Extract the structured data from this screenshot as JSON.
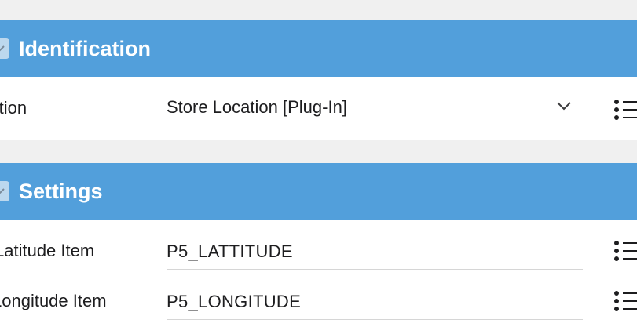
{
  "identification": {
    "title": "Identification",
    "fields": {
      "action": {
        "label": "Action",
        "value": "Store Location [Plug-In]"
      }
    }
  },
  "settings": {
    "title": "Settings",
    "fields": {
      "latitude": {
        "label": "Latitude Item",
        "value": "P5_LATTITUDE"
      },
      "longitude": {
        "label": "Longitude Item",
        "value": "P5_LONGITUDE"
      }
    }
  },
  "icons": {
    "collapse": "chevron-down-icon",
    "select_caret": "chevron-down-icon",
    "list_picker": "list-icon"
  },
  "colors": {
    "header_blue": "#529fdb",
    "page_background": "#f0f0f0",
    "panel_background": "#ffffff"
  }
}
